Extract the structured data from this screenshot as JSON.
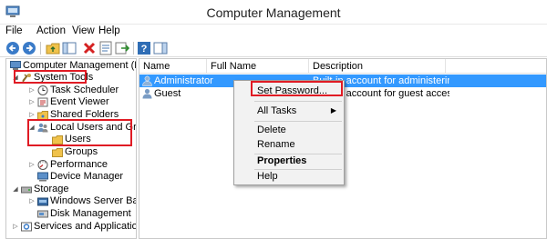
{
  "window": {
    "title": "Computer Management"
  },
  "menu": [
    "File",
    "Action",
    "View",
    "Help"
  ],
  "toolbar": {
    "buttons": [
      "back-arrow-icon",
      "forward-arrow-icon",
      "up-folder-icon",
      "show-hide-tree-icon",
      "delete-icon",
      "properties-icon",
      "export-icon",
      "help-icon",
      "show-hide-action-pane-icon"
    ]
  },
  "tree": {
    "root": "Computer Management (Local",
    "system_tools": "System Tools",
    "task_scheduler": "Task Scheduler",
    "event_viewer": "Event Viewer",
    "shared_folders": "Shared Folders",
    "local_users_groups": "Local Users and Groups",
    "users": "Users",
    "groups": "Groups",
    "performance": "Performance",
    "device_manager": "Device Manager",
    "storage": "Storage",
    "windows_server_backup": "Windows Server Backup",
    "disk_management": "Disk Management",
    "services_apps": "Services and Applications"
  },
  "list": {
    "headers": {
      "name": "Name",
      "full_name": "Full Name",
      "description": "Description"
    },
    "rows": [
      {
        "name": "Administrator",
        "full_name": "",
        "description": "Built-in account for administering..."
      },
      {
        "name": "Guest",
        "full_name": "",
        "description": "Built-in account for guest access t..."
      }
    ]
  },
  "context_menu": {
    "set_password": "Set Password...",
    "all_tasks": "All Tasks",
    "delete": "Delete",
    "rename": "Rename",
    "properties": "Properties",
    "help": "Help"
  },
  "colors": {
    "highlight": "#e01b24",
    "selection": "#3399ff"
  }
}
